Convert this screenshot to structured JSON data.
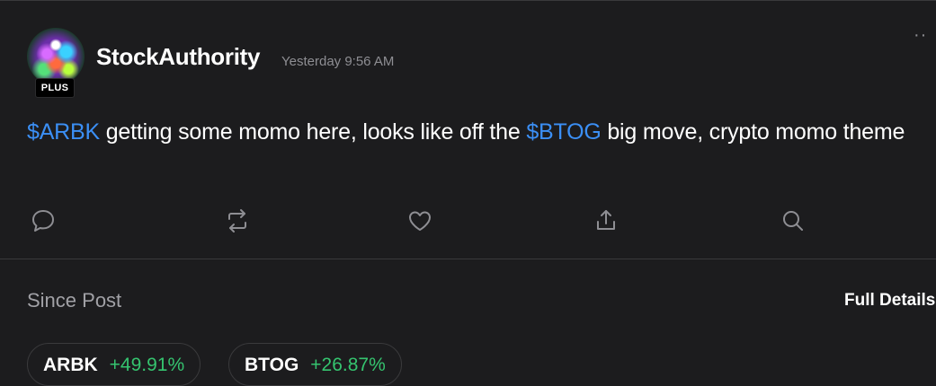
{
  "post": {
    "username": "StockAuthority",
    "badge": "PLUS",
    "timestamp": "Yesterday 9:56 AM",
    "more_icon": "more-dots-icon",
    "text_segments": [
      {
        "text": "$ARBK",
        "cashtag": true
      },
      {
        "text": " getting some momo here, looks like off the ",
        "cashtag": false
      },
      {
        "text": "$BTOG",
        "cashtag": true
      },
      {
        "text": " big move, crypto momo theme",
        "cashtag": false
      }
    ]
  },
  "actions": [
    {
      "name": "comment-icon"
    },
    {
      "name": "repost-icon"
    },
    {
      "name": "like-icon"
    },
    {
      "name": "share-icon"
    },
    {
      "name": "search-icon"
    }
  ],
  "since_post": {
    "label": "Since Post",
    "full_details": "Full Details",
    "tickers": [
      {
        "symbol": "ARBK",
        "change": "+49.91%"
      },
      {
        "symbol": "BTOG",
        "change": "+26.87%"
      }
    ]
  },
  "colors": {
    "background": "#1c1c1e",
    "cashtag": "#3b8ff5",
    "positive": "#35c46f",
    "muted": "#8e8e93"
  }
}
